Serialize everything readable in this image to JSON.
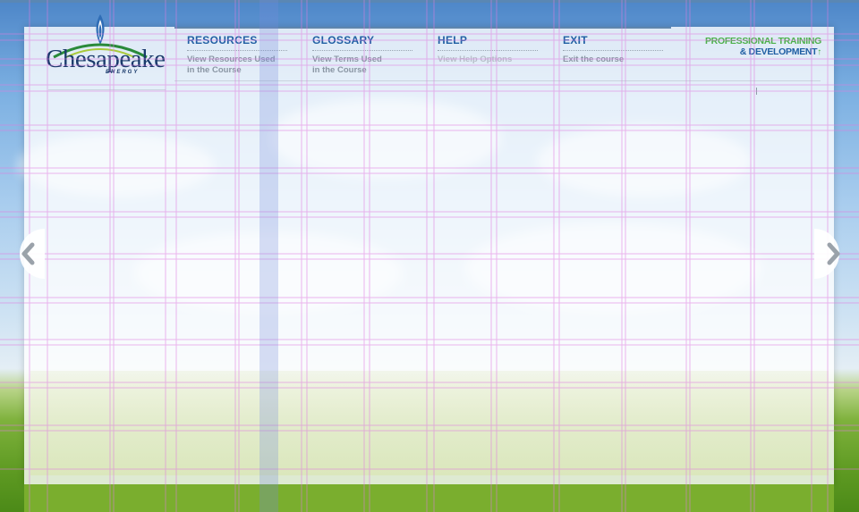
{
  "brand": {
    "logo_text": "Chesapeake",
    "logo_subtext": "ENERGY"
  },
  "nav": {
    "items": [
      {
        "title": "RESOURCES",
        "subtitle_line1": "View Resources Used",
        "subtitle_line2": "in the Course"
      },
      {
        "title": "GLOSSARY",
        "subtitle_line1": "View Terms Used",
        "subtitle_line2": "in the Course"
      },
      {
        "title": "HELP",
        "subtitle_line1": "View Help Options",
        "subtitle_line2": ""
      },
      {
        "title": "EXIT",
        "subtitle_line1": "Exit the course",
        "subtitle_line2": ""
      }
    ]
  },
  "program": {
    "line1": "PROFESSIONAL TRAINING",
    "line2": "& DEVELOPMENT",
    "arrow_glyph": "↑"
  },
  "controls": {
    "prev_icon": "chevron-left-icon",
    "next_icon": "chevron-right-icon"
  },
  "colors": {
    "nav_title": "#1f5fa3",
    "nav_subtitle": "#8a96a4",
    "program_green": "#4cb04a",
    "program_blue": "#1f5fa3",
    "guide_lines": "#e07be0",
    "footer_green": "#7aae2e"
  }
}
